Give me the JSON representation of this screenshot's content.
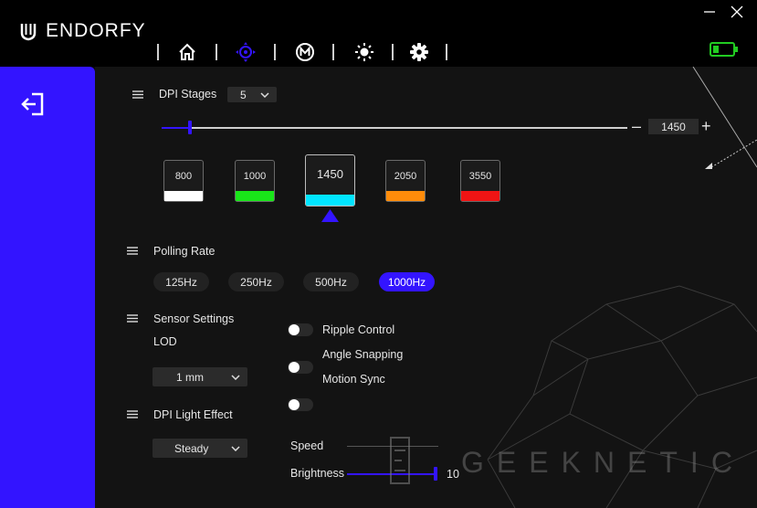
{
  "app": {
    "brand": "ENDORFY"
  },
  "colors": {
    "accent": "#3314ff",
    "battery": "#22cc22"
  },
  "nav": [
    {
      "icon": "home-icon"
    },
    {
      "icon": "dpi-target-icon",
      "active": true
    },
    {
      "icon": "macro-m-icon"
    },
    {
      "icon": "lighting-sun-icon"
    },
    {
      "icon": "settings-gear-icon"
    }
  ],
  "dpi": {
    "title": "DPI Stages",
    "stages_count": "5",
    "current_value": "1450",
    "slider_fraction": 0.06,
    "stages": [
      {
        "value": "800",
        "color": "#ffffff"
      },
      {
        "value": "1000",
        "color": "#19e619"
      },
      {
        "value": "1450",
        "color": "#00e5ff",
        "selected": true
      },
      {
        "value": "2050",
        "color": "#ff8c0a"
      },
      {
        "value": "3550",
        "color": "#f01414"
      }
    ]
  },
  "polling": {
    "title": "Polling Rate",
    "options": [
      "125Hz",
      "250Hz",
      "500Hz",
      "1000Hz"
    ],
    "selected": "1000Hz"
  },
  "sensor": {
    "title": "Sensor Settings",
    "lod_label": "LOD",
    "lod_value": "1 mm",
    "toggles": [
      "Ripple Control",
      "Angle Snapping",
      "Motion Sync"
    ]
  },
  "light": {
    "title": "DPI Light Effect",
    "effect": "Steady",
    "speed_label": "Speed",
    "brightness_label": "Brightness",
    "brightness_value": "10"
  },
  "watermark": "GEEKNETIC"
}
